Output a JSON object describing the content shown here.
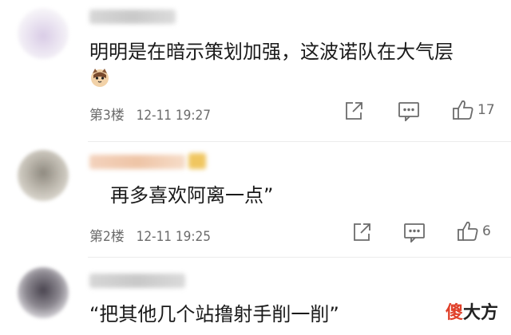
{
  "comments": [
    {
      "text": "明明是在暗示策划加强，这波诺队在大气层",
      "floor": "第3楼",
      "time": "12-11 19:27",
      "likes": "17",
      "has_emoji": true
    },
    {
      "text": "再多喜欢阿离一点”",
      "floor": "第2楼",
      "time": "12-11 19:25",
      "likes": "6",
      "has_emoji": false
    },
    {
      "text": "“把其他几个站撸射手削一削”",
      "floor": "",
      "time": "",
      "likes": "",
      "has_emoji": false
    }
  ],
  "watermark": {
    "part1": "傻",
    "part2": "大方"
  },
  "icons": {
    "share": "share-icon",
    "reply": "comment-icon",
    "like": "thumbs-up-icon"
  },
  "colors": {
    "meta": "#6b6b6b",
    "text": "#1a1a1a",
    "divider": "#ececec"
  }
}
